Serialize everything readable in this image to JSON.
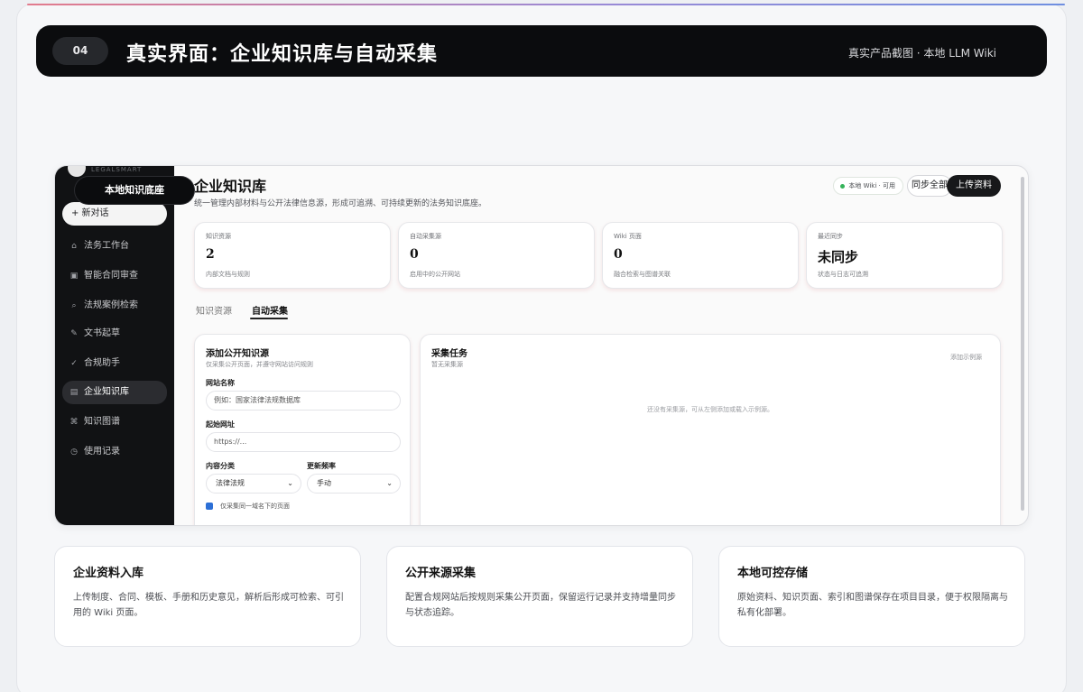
{
  "slide": {
    "number": "04",
    "title": "真实界面：企业知识库与自动采集",
    "source": "真实产品截图 · 本地 LLM Wiki"
  },
  "app": {
    "brand": "LEGALSMART",
    "kb_pill": "本地知识底座",
    "new_chat": "+ 新对话",
    "nav": [
      {
        "label": "法务工作台",
        "icon": "home-icon"
      },
      {
        "label": "智能合同审查",
        "icon": "doc-review-icon"
      },
      {
        "label": "法规案例检索",
        "icon": "search-icon"
      },
      {
        "label": "文书起草",
        "icon": "pen-icon"
      },
      {
        "label": "合规助手",
        "icon": "check-icon"
      },
      {
        "label": "企业知识库",
        "icon": "kb-icon",
        "active": true
      },
      {
        "label": "知识图谱",
        "icon": "graph-icon"
      },
      {
        "label": "使用记录",
        "icon": "history-icon"
      }
    ],
    "page_title": "企业知识库",
    "page_subtitle": "统一管理内部材料与公开法律信息源，形成可追溯、可持续更新的法务知识底座。",
    "status": "本地 Wiki · 可用",
    "sync_button": "同步全部",
    "upload_button": "上传资料",
    "stats": [
      {
        "label": "知识资源",
        "value": "2",
        "desc": "内部文档与规则"
      },
      {
        "label": "自动采集源",
        "value": "0",
        "desc": "启用中的公开网站"
      },
      {
        "label": "Wiki 页面",
        "value": "0",
        "desc": "融合检索与图谱关联"
      },
      {
        "label": "最近同步",
        "value": "未同步",
        "desc": "状态与日志可追溯"
      }
    ],
    "tabs": [
      "知识资源",
      "自动采集"
    ],
    "form": {
      "title": "添加公开知识源",
      "subtitle": "仅采集公开页面，并遵守网站访问规则",
      "site_name_label": "网站名称",
      "site_name_placeholder": "例如：国家法律法规数据库",
      "start_url_label": "起始网址",
      "start_url_placeholder": "https://...",
      "category_label": "内容分类",
      "category_value": "法律法规",
      "frequency_label": "更新频率",
      "frequency_value": "手动",
      "checkbox_label": "仅采集同一域名下的页面"
    },
    "tasks": {
      "title": "采集任务",
      "subtitle": "暂无采集源",
      "add_example": "添加示例源",
      "empty": "还没有采集源，可从左侧添加或载入示例源。"
    }
  },
  "features": [
    {
      "title": "企业资料入库",
      "desc": "上传制度、合同、模板、手册和历史意见，解析后形成可检索、可引用的 Wiki 页面。"
    },
    {
      "title": "公开来源采集",
      "desc": "配置合规网站后按规则采集公开页面，保留运行记录并支持增量同步与状态追踪。"
    },
    {
      "title": "本地可控存储",
      "desc": "原始资料、知识页面、索引和图谱保存在项目目录，便于权限隔离与私有化部署。"
    }
  ]
}
